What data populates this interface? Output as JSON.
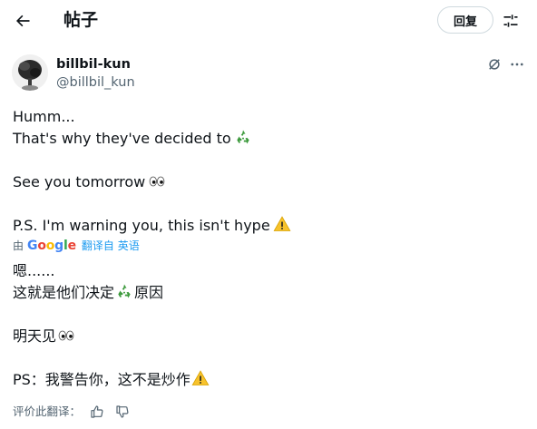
{
  "header": {
    "title": "帖子",
    "reply_label": "回复",
    "icons": [
      "back-arrow-icon",
      "filter-sliders-icon"
    ]
  },
  "author": {
    "display_name": "billbil-kun",
    "handle": "@billbil_kun"
  },
  "tweet": {
    "original": [
      "Humm...",
      "That's why they've decided to",
      "See you tomorrow",
      "P.S. I'm warning you, this isn't hype"
    ],
    "translated": [
      "嗯......",
      "这就是他们决定",
      "原因",
      "明天见",
      "PS：我警告你，这不是炒作"
    ]
  },
  "translation": {
    "by_label": "由",
    "google_letters": [
      "G",
      "o",
      "o",
      "g",
      "l",
      "e"
    ],
    "link_label": "翻译自 英语"
  },
  "rating": {
    "prompt": "评价此翻译："
  },
  "colors": {
    "text": "#0f1419",
    "secondary": "#536471",
    "link": "#1d9bf0",
    "border": "#cfd9de"
  }
}
